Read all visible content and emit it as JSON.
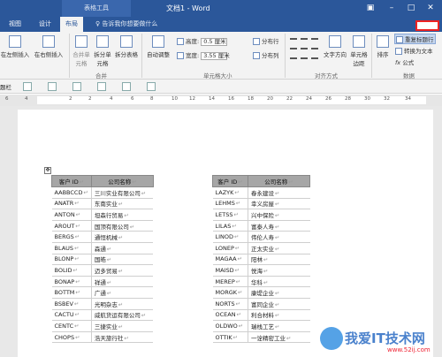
{
  "window": {
    "context_tab": "表格工具",
    "title": "文档1 - Word"
  },
  "tabs": [
    {
      "label": "视图"
    },
    {
      "label": "设计"
    },
    {
      "label": "布局"
    }
  ],
  "tell_me": "告诉我你想要做什么",
  "ribbon": {
    "insert_left": "在左侧插入",
    "insert_right": "在右侧插入",
    "merge_cells": "合并单元格",
    "split_cells": "拆分单元格",
    "split_table": "拆分表格",
    "autofit": "自动调整",
    "height_label": "高度:",
    "height_value": "0.5 厘米",
    "width_label": "宽度:",
    "width_value": "3.55 厘米",
    "distribute_rows": "分布行",
    "distribute_cols": "分布列",
    "text_direction": "文字方向",
    "cell_margins": "单元格边距",
    "sort": "排序",
    "repeat_header": "重复标题行",
    "convert_text": "转换为文本",
    "formula": "公式",
    "group_merge": "合并",
    "group_cellsize": "单元格大小",
    "group_align": "对齐方式",
    "group_data": "数据"
  },
  "toolbar2": {
    "label": "题栏"
  },
  "ruler": {
    "numbers": [
      "6",
      "4",
      "2",
      "2",
      "4",
      "6",
      "8",
      "10",
      "12",
      "14",
      "16",
      "18",
      "20",
      "22",
      "24",
      "26",
      "28",
      "30",
      "32",
      "34"
    ]
  },
  "table_left": {
    "headers": [
      "客户 ID",
      "公司名称"
    ],
    "rows": [
      [
        "AABBCCD",
        "三川实业有限公司"
      ],
      [
        "ANATR",
        "东南实业"
      ],
      [
        "ANTON",
        "坦森行贸易"
      ],
      [
        "AROUT",
        "国顶有限公司"
      ],
      [
        "BERGS",
        "通恒机械"
      ],
      [
        "BLAUS",
        "森通"
      ],
      [
        "BLONP",
        "国皓"
      ],
      [
        "BOLID",
        "迈多贸易"
      ],
      [
        "BONAP",
        "祥通"
      ],
      [
        "BOTTM",
        "广通"
      ],
      [
        "BSBEV",
        "光明杂志"
      ],
      [
        "CACTU",
        "威航货运有限公司"
      ],
      [
        "CENTC",
        "三捷实业"
      ],
      [
        "CHOPS",
        "浩天旅行社"
      ]
    ]
  },
  "table_right": {
    "headers": [
      "客户 ID",
      "公司名称"
    ],
    "rows": [
      [
        "LAZYK",
        "春永建设"
      ],
      [
        "LEHMS",
        "幸义房屋"
      ],
      [
        "LETSS",
        "兴中保险"
      ],
      [
        "LILAS",
        "富泰人寿"
      ],
      [
        "LINOD",
        "伟伦人寿"
      ],
      [
        "LONEP",
        "正太实业"
      ],
      [
        "MAGAA",
        "阳林"
      ],
      [
        "MAISD",
        "悦海"
      ],
      [
        "MEREP",
        "华科"
      ],
      [
        "MORGK",
        "康堤企业"
      ],
      [
        "NORTS",
        "富同企业"
      ],
      [
        "OCEAN",
        "利合材料"
      ],
      [
        "OLDWO",
        "瑞栈工艺"
      ],
      [
        "OTTIK",
        "一诠精密工业"
      ]
    ]
  },
  "watermark": {
    "text": "我爱IT技术网",
    "url": "www.52ij.com"
  }
}
